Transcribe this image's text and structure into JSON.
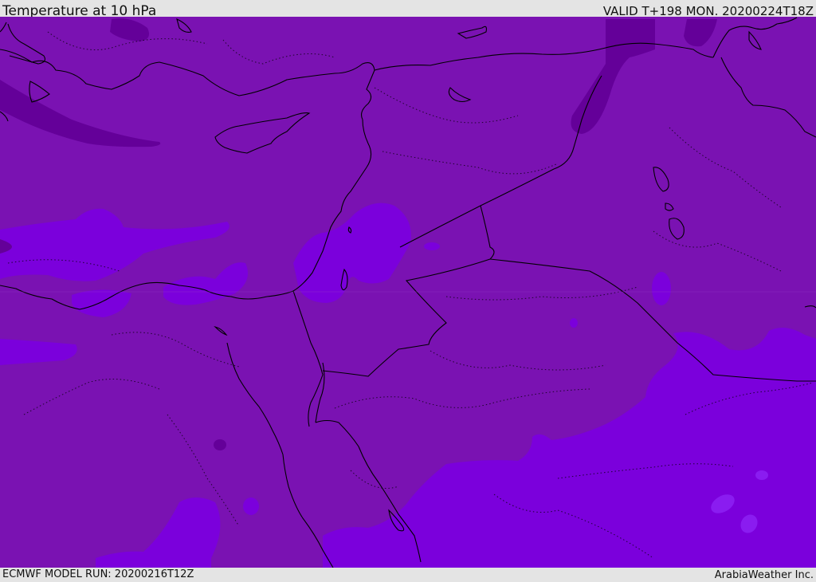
{
  "header": {
    "title": "Temperature at 10 hPa",
    "valid": "VALID T+198 MON. 20200224T18Z"
  },
  "footer": {
    "model_run": "ECMWF MODEL RUN: 20200216T12Z",
    "credit": "ArabiaWeather Inc."
  },
  "colors": {
    "base_fill": "#7a12b2",
    "warmer_fill": "#7b00dc",
    "cooler_fill": "#640099",
    "spot_fill": "#8a1cf0",
    "coastline": "#000000"
  }
}
